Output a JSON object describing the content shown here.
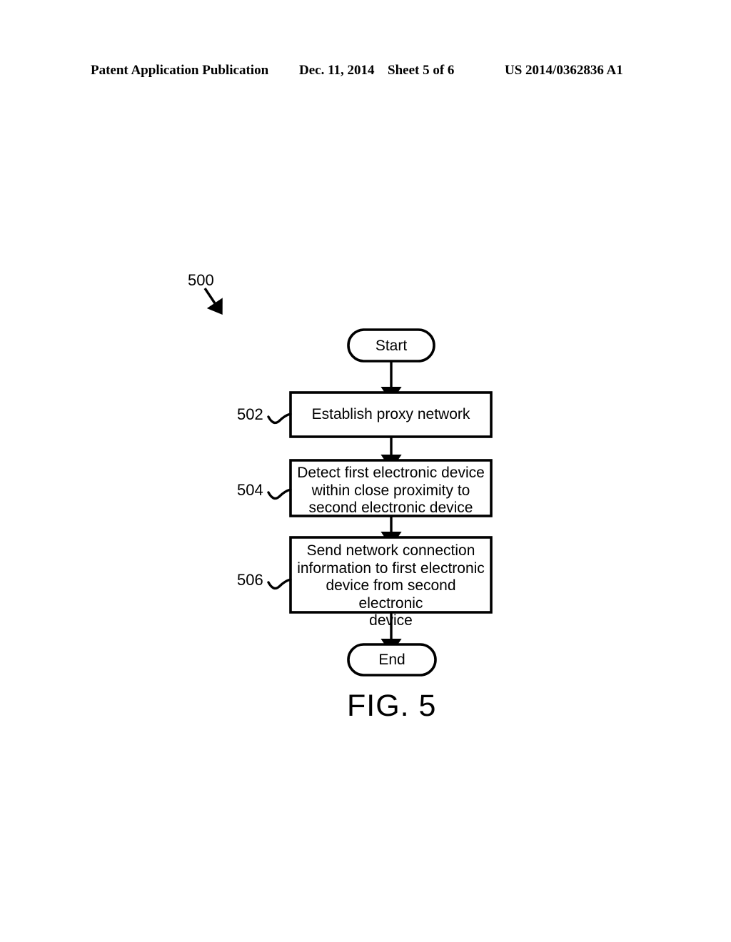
{
  "header": {
    "publication": "Patent Application Publication",
    "date": "Dec. 11, 2014",
    "sheet": "Sheet 5 of 6",
    "patent_number": "US 2014/0362836 A1"
  },
  "figure": {
    "caption": "FIG. 5",
    "diagram_ref": "500",
    "line_color": "#000000",
    "fill_color": "#ffffff"
  },
  "flowchart": {
    "start_label": "Start",
    "end_label": "End",
    "steps": [
      {
        "ref": "502",
        "text": "Establish proxy network"
      },
      {
        "ref": "504",
        "text": "Detect first electronic device\nwithin close proximity to\nsecond electronic device"
      },
      {
        "ref": "506",
        "text": "Send network connection\ninformation to first electronic\ndevice from second electronic\ndevice"
      }
    ]
  }
}
